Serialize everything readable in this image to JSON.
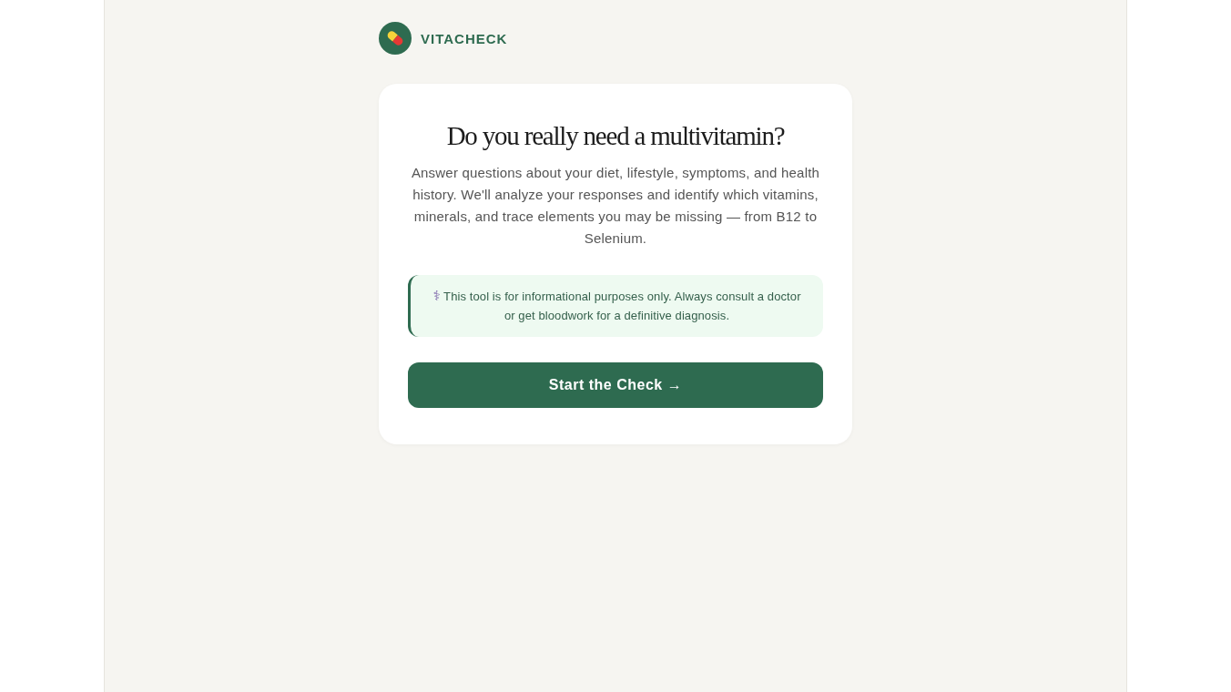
{
  "brand": {
    "name": "VITACHECK"
  },
  "intro": {
    "title": "Do you really need a multivitamin?",
    "description": "Answer questions about your diet, lifestyle, symptoms, and health history. We'll analyze your responses and identify which vitamins, minerals, and trace elements you may be missing — from B12 to Selenium."
  },
  "disclaimer": {
    "icon": "⚕",
    "text": "This tool is for informational purposes only. Always consult a doctor or get bloodwork for a definitive diagnosis."
  },
  "start_button": {
    "label": "Start the Check →"
  }
}
